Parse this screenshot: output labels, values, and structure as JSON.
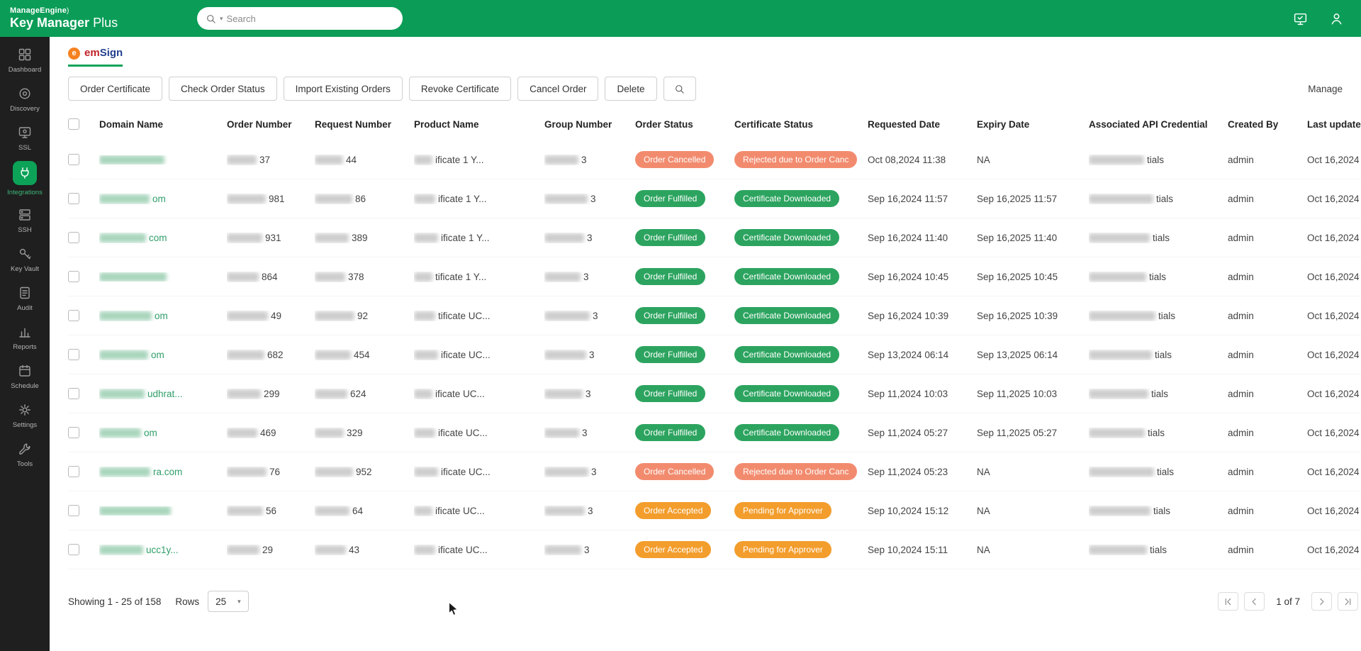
{
  "header": {
    "brand_line1": "ManageEngine",
    "brand_line2_strong": "Key Manager",
    "brand_line2_light": "Plus",
    "search_placeholder": "Search"
  },
  "sidebar": {
    "items": [
      {
        "label": "Dashboard",
        "icon": "grid",
        "active": false
      },
      {
        "label": "Discovery",
        "icon": "target",
        "active": false
      },
      {
        "label": "SSL",
        "icon": "ssl",
        "active": false
      },
      {
        "label": "Integrations",
        "icon": "plug",
        "active": true
      },
      {
        "label": "SSH",
        "icon": "ssh",
        "active": false
      },
      {
        "label": "Key Vault",
        "icon": "key",
        "active": false
      },
      {
        "label": "Audit",
        "icon": "audit",
        "active": false
      },
      {
        "label": "Reports",
        "icon": "reports",
        "active": false
      },
      {
        "label": "Schedule",
        "icon": "calendar",
        "active": false
      },
      {
        "label": "Settings",
        "icon": "gear",
        "active": false
      },
      {
        "label": "Tools",
        "icon": "wrench",
        "active": false
      }
    ]
  },
  "tab": {
    "circle_letter": "e",
    "name_red": "em",
    "name_blue": "Sign"
  },
  "toolbar": {
    "buttons": [
      "Order Certificate",
      "Check Order Status",
      "Import Existing Orders",
      "Revoke Certificate",
      "Cancel Order",
      "Delete"
    ],
    "manage_label": "Manage"
  },
  "table": {
    "columns": [
      "Domain Name",
      "Order Number",
      "Request Number",
      "Product Name",
      "Group Number",
      "Order Status",
      "Certificate Status",
      "Requested Date",
      "Expiry Date",
      "Associated API Credential",
      "Created By",
      "Last updated"
    ],
    "rows": [
      {
        "domain_tail": "",
        "order_tail": "37",
        "request_tail": "44",
        "product_tail": "ificate 1 Y...",
        "group_tail": "3",
        "order_status": {
          "label": "Order Cancelled",
          "type": "cancelled"
        },
        "cert_status": {
          "label": "Rejected due to Order Canc",
          "type": "rejected"
        },
        "requested": "Oct 08,2024 11:38",
        "expiry": "NA",
        "api_tail": "tials",
        "created_by": "admin",
        "last_updated": "Oct 16,2024"
      },
      {
        "domain_tail": "om",
        "order_tail": "981",
        "request_tail": "86",
        "product_tail": "ificate 1 Y...",
        "group_tail": "3",
        "order_status": {
          "label": "Order Fulfilled",
          "type": "fulfilled"
        },
        "cert_status": {
          "label": "Certificate Downloaded",
          "type": "downloaded"
        },
        "requested": "Sep 16,2024 11:57",
        "expiry": "Sep 16,2025 11:57",
        "api_tail": "tials",
        "created_by": "admin",
        "last_updated": "Oct 16,2024"
      },
      {
        "domain_tail": "com",
        "order_tail": "931",
        "request_tail": "389",
        "product_tail": "ificate 1 Y...",
        "group_tail": "3",
        "order_status": {
          "label": "Order Fulfilled",
          "type": "fulfilled"
        },
        "cert_status": {
          "label": "Certificate Downloaded",
          "type": "downloaded"
        },
        "requested": "Sep 16,2024 11:40",
        "expiry": "Sep 16,2025 11:40",
        "api_tail": "tials",
        "created_by": "admin",
        "last_updated": "Oct 16,2024"
      },
      {
        "domain_tail": "",
        "order_tail": "864",
        "request_tail": "378",
        "product_tail": "tificate 1 Y...",
        "group_tail": "3",
        "order_status": {
          "label": "Order Fulfilled",
          "type": "fulfilled"
        },
        "cert_status": {
          "label": "Certificate Downloaded",
          "type": "downloaded"
        },
        "requested": "Sep 16,2024 10:45",
        "expiry": "Sep 16,2025 10:45",
        "api_tail": "tials",
        "created_by": "admin",
        "last_updated": "Oct 16,2024"
      },
      {
        "domain_tail": "om",
        "order_tail": "49",
        "request_tail": "92",
        "product_tail": "tificate UC...",
        "group_tail": "3",
        "order_status": {
          "label": "Order Fulfilled",
          "type": "fulfilled"
        },
        "cert_status": {
          "label": "Certificate Downloaded",
          "type": "downloaded"
        },
        "requested": "Sep 16,2024 10:39",
        "expiry": "Sep 16,2025 10:39",
        "api_tail": "tials",
        "created_by": "admin",
        "last_updated": "Oct 16,2024"
      },
      {
        "domain_tail": "om",
        "order_tail": "682",
        "request_tail": "454",
        "product_tail": "ificate UC...",
        "group_tail": "3",
        "order_status": {
          "label": "Order Fulfilled",
          "type": "fulfilled"
        },
        "cert_status": {
          "label": "Certificate Downloaded",
          "type": "downloaded"
        },
        "requested": "Sep 13,2024 06:14",
        "expiry": "Sep 13,2025 06:14",
        "api_tail": "tials",
        "created_by": "admin",
        "last_updated": "Oct 16,2024"
      },
      {
        "domain_tail": "udhrat...",
        "order_tail": "299",
        "request_tail": "624",
        "product_tail": "ificate UC...",
        "group_tail": "3",
        "order_status": {
          "label": "Order Fulfilled",
          "type": "fulfilled"
        },
        "cert_status": {
          "label": "Certificate Downloaded",
          "type": "downloaded"
        },
        "requested": "Sep 11,2024 10:03",
        "expiry": "Sep 11,2025 10:03",
        "api_tail": "tials",
        "created_by": "admin",
        "last_updated": "Oct 16,2024"
      },
      {
        "domain_tail": "om",
        "order_tail": "469",
        "request_tail": "329",
        "product_tail": "ificate UC...",
        "group_tail": "3",
        "order_status": {
          "label": "Order Fulfilled",
          "type": "fulfilled"
        },
        "cert_status": {
          "label": "Certificate Downloaded",
          "type": "downloaded"
        },
        "requested": "Sep 11,2024 05:27",
        "expiry": "Sep 11,2025 05:27",
        "api_tail": "tials",
        "created_by": "admin",
        "last_updated": "Oct 16,2024"
      },
      {
        "domain_tail": "ra.com",
        "order_tail": "76",
        "request_tail": "952",
        "product_tail": "ificate UC...",
        "group_tail": "3",
        "order_status": {
          "label": "Order Cancelled",
          "type": "cancelled"
        },
        "cert_status": {
          "label": "Rejected due to Order Canc",
          "type": "rejected"
        },
        "requested": "Sep 11,2024 05:23",
        "expiry": "NA",
        "api_tail": "tials",
        "created_by": "admin",
        "last_updated": "Oct 16,2024"
      },
      {
        "domain_tail": "",
        "order_tail": "56",
        "request_tail": "64",
        "product_tail": "ificate UC...",
        "group_tail": "3",
        "order_status": {
          "label": "Order Accepted",
          "type": "accepted"
        },
        "cert_status": {
          "label": "Pending for Approver",
          "type": "pending"
        },
        "requested": "Sep 10,2024 15:12",
        "expiry": "NA",
        "api_tail": "tials",
        "created_by": "admin",
        "last_updated": "Oct 16,2024"
      },
      {
        "domain_tail": "ucc1y...",
        "order_tail": "29",
        "request_tail": "43",
        "product_tail": "ificate UC...",
        "group_tail": "3",
        "order_status": {
          "label": "Order Accepted",
          "type": "accepted"
        },
        "cert_status": {
          "label": "Pending for Approver",
          "type": "pending"
        },
        "requested": "Sep 10,2024 15:11",
        "expiry": "NA",
        "api_tail": "tials",
        "created_by": "admin",
        "last_updated": "Oct 16,2024"
      }
    ]
  },
  "footer": {
    "showing": "Showing 1 - 25 of 158",
    "rows_label": "Rows",
    "rows_value": "25",
    "page_info": "1 of 7"
  },
  "colors": {
    "header_green": "#0b9d57",
    "active_green": "#0ca258",
    "badge_green": "#2ca45f",
    "badge_salmon": "#f28b6e",
    "badge_orange": "#f39d2c",
    "link_green": "#2f9e68"
  }
}
